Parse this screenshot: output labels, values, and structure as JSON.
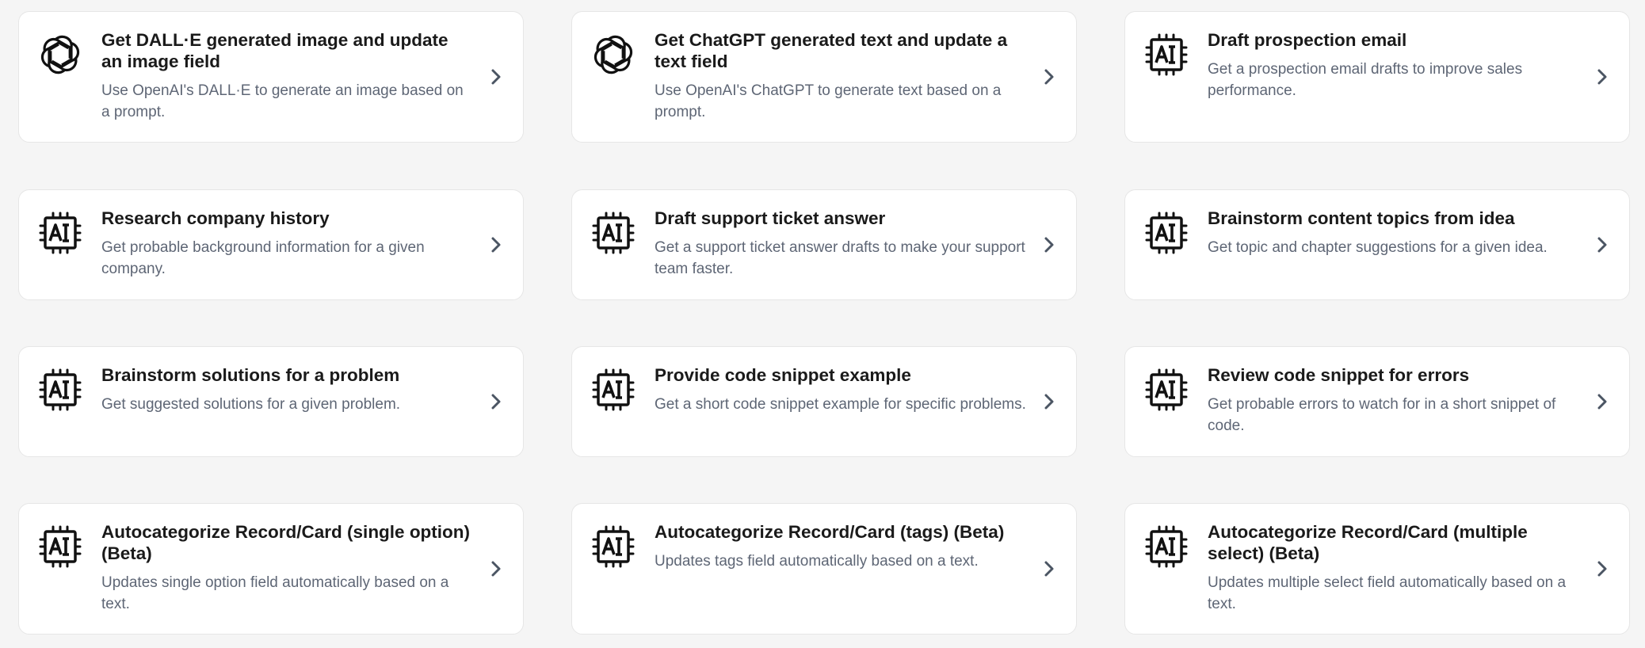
{
  "cards": [
    {
      "title": "Get DALL·E generated image and update an image field",
      "description": "Use OpenAI's DALL·E to generate an image based on a prompt.",
      "icon": "openai-icon"
    },
    {
      "title": "Get ChatGPT generated text and update a text field",
      "description": "Use OpenAI's ChatGPT to generate text based on a prompt.",
      "icon": "openai-icon"
    },
    {
      "title": "Draft prospection email",
      "description": "Get a prospection email drafts to improve sales performance.",
      "icon": "ai-chip-icon"
    },
    {
      "title": "Research company history",
      "description": "Get probable background information for a given company.",
      "icon": "ai-chip-icon"
    },
    {
      "title": "Draft support ticket answer",
      "description": "Get a support ticket answer drafts to make your support team faster.",
      "icon": "ai-chip-icon"
    },
    {
      "title": "Brainstorm content topics from idea",
      "description": "Get topic and chapter suggestions for a given idea.",
      "icon": "ai-chip-icon"
    },
    {
      "title": "Brainstorm solutions for a problem",
      "description": "Get suggested solutions for a given problem.",
      "icon": "ai-chip-icon"
    },
    {
      "title": "Provide code snippet example",
      "description": "Get a short code snippet example for specific problems.",
      "icon": "ai-chip-icon"
    },
    {
      "title": "Review code snippet for errors",
      "description": "Get probable errors to watch for in a short snippet of code.",
      "icon": "ai-chip-icon"
    },
    {
      "title": "Autocategorize Record/Card (single option) (Beta)",
      "description": "Updates single option field automatically based on a text.",
      "icon": "ai-chip-icon"
    },
    {
      "title": "Autocategorize Record/Card (tags) (Beta)",
      "description": "Updates tags field automatically based on a text.",
      "icon": "ai-chip-icon"
    },
    {
      "title": "Autocategorize Record/Card (multiple select) (Beta)",
      "description": "Updates multiple select field automatically based on a text.",
      "icon": "ai-chip-icon"
    }
  ],
  "colors": {
    "background": "#f5f5f5",
    "card": "#ffffff",
    "title": "#1a1a1a",
    "description": "#5e6675",
    "chevron": "#4b5563"
  }
}
